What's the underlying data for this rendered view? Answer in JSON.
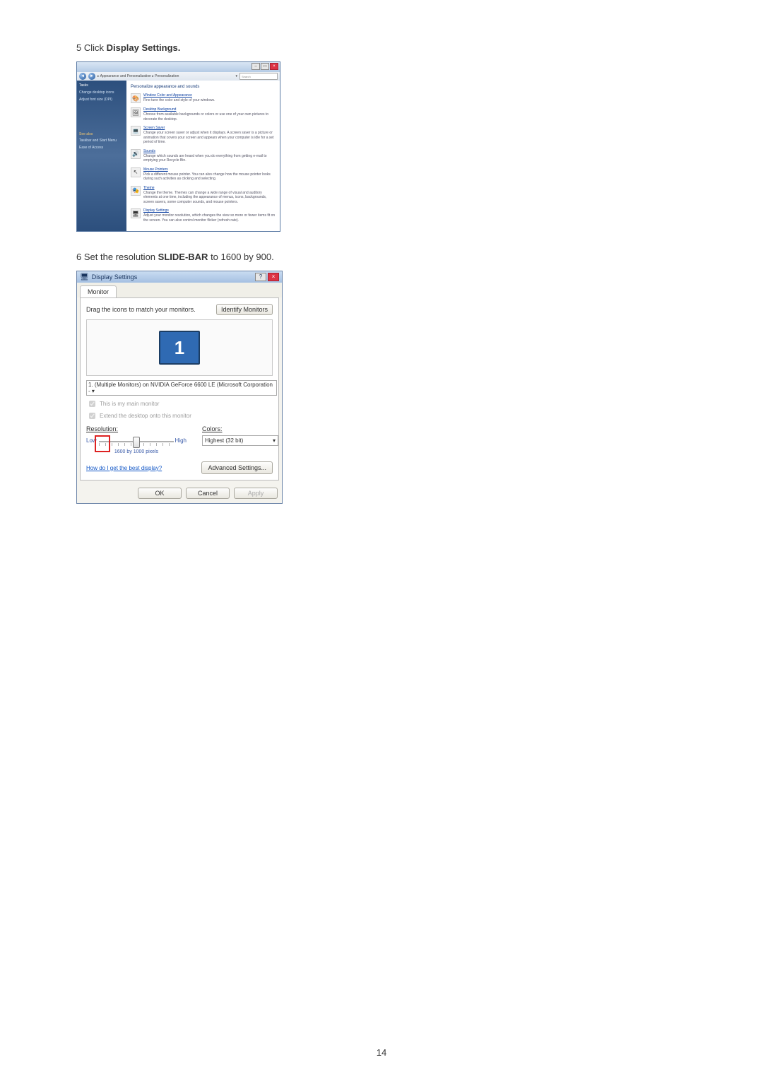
{
  "step5": {
    "num": "5",
    "pre": "Click ",
    "bold": "Display Settings."
  },
  "step6": {
    "num": "6",
    "pre": "Set the resolution ",
    "bold": "SLIDE-BAR",
    "post": " to 1600 by 900."
  },
  "pwin": {
    "breadcrumb": "▸ Appearance and Personalization ▸ Personalization",
    "search_placeholder": "Search",
    "side": {
      "tasks": "Tasks",
      "changeIcons": "Change desktop icons",
      "adjustFont": "Adjust font size (DPI)",
      "seeAlso": "See also",
      "taskbar": "Taskbar and Start Menu",
      "ease": "Ease of Access"
    },
    "main_title": "Personalize appearance and sounds",
    "items": [
      {
        "icon": "🎨",
        "label": "Window Color and Appearance",
        "desc": "Fine tune the color and style of your windows."
      },
      {
        "icon": "🖼",
        "label": "Desktop Background",
        "desc": "Choose from available backgrounds or colors or use one of your own pictures to decorate the desktop."
      },
      {
        "icon": "💻",
        "label": "Screen Saver",
        "desc": "Change your screen saver or adjust when it displays. A screen saver is a picture or animation that covers your screen and appears when your computer is idle for a set period of time."
      },
      {
        "icon": "🔊",
        "label": "Sounds",
        "desc": "Change which sounds are heard when you do everything from getting e-mail to emptying your Recycle Bin."
      },
      {
        "icon": "↖",
        "label": "Mouse Pointers",
        "desc": "Pick a different mouse pointer. You can also change how the mouse pointer looks during such activities as clicking and selecting."
      },
      {
        "icon": "🎭",
        "label": "Theme",
        "desc": "Change the theme. Themes can change a wide range of visual and auditory elements at one time, including the appearance of menus, icons, backgrounds, screen savers, some computer sounds, and mouse pointers."
      },
      {
        "icon": "🖥",
        "label": "Display Settings",
        "desc": "Adjust your monitor resolution, which changes the view so more or fewer items fit on the screen. You can also control monitor flicker (refresh rate)."
      }
    ]
  },
  "dwin": {
    "title": "Display Settings",
    "tab": "Monitor",
    "dragText": "Drag the icons to match your monitors.",
    "identify": "Identify Monitors",
    "monitorNumber": "1",
    "monitorSelect": "1. (Multiple Monitors) on NVIDIA GeForce 6600 LE (Microsoft Corporation - ▾",
    "chkMain": "This is my main monitor",
    "chkExtend": "Extend the desktop onto this monitor",
    "resolutionLabel": "Resolution:",
    "low": "Low",
    "high": "High",
    "sliderCaption": "1600 by 1000 pixels",
    "colorsLabel": "Colors:",
    "colorsValue": "Highest (32 bit)",
    "help": "How do I get the best display?",
    "advanced": "Advanced Settings...",
    "ok": "OK",
    "cancel": "Cancel",
    "apply": "Apply"
  },
  "pageNumber": "14"
}
